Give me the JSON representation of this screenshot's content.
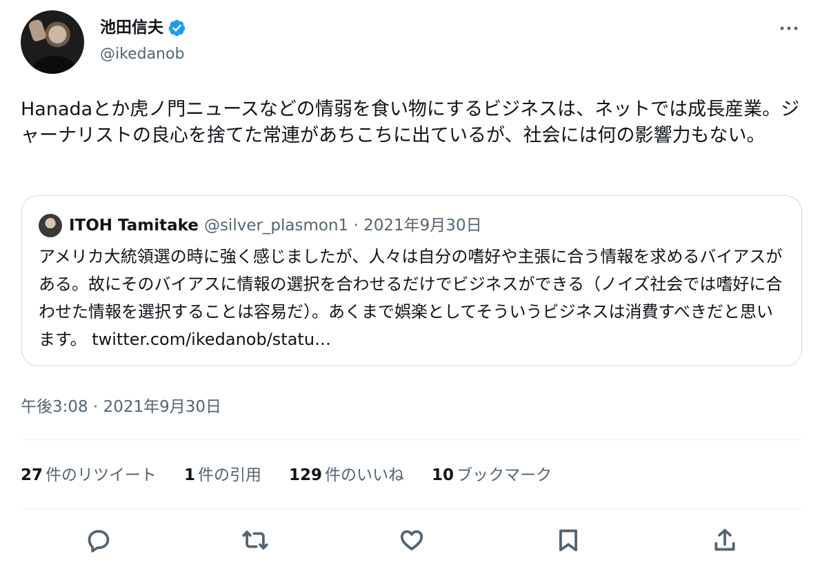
{
  "author": {
    "name": "池田信夫",
    "handle": "@ikedanob"
  },
  "tweet": {
    "text": "Hanadaとか虎ノ門ニュースなどの情弱を食い物にするビジネスは、ネットでは成長産業。ジャーナリストの良心を捨てた常連があちこちに出ているが、社会には何の影響力もない。"
  },
  "quote": {
    "name": "ITOH Tamitake",
    "handle": "@silver_plasmon1",
    "date": "2021年9月30日",
    "text": "アメリカ大統領選の時に強く感じましたが、人々は自分の嗜好や主張に合う情報を求めるバイアスがある。故にそのバイアスに情報の選択を合わせるだけでビジネスができる（ノイズ社会では嗜好に合わせた情報を選択することは容易だ）。あくまで娯楽としてそういうビジネスは消費すべきだと思います。 ",
    "link": "twitter.com/ikedanob/statu…"
  },
  "timestamp": "午後3:08 · 2021年9月30日",
  "stats": {
    "retweets": "27",
    "retweets_label": "件のリツイート",
    "quotes": "1",
    "quotes_label": "件の引用",
    "likes": "129",
    "likes_label": "件のいいね",
    "bookmarks": "10",
    "bookmarks_label": "ブックマーク"
  },
  "icons": {
    "verified": "verified-badge-icon",
    "more": "more-dots-icon",
    "reply": "reply-icon",
    "retweet": "retweet-icon",
    "like": "heart-icon",
    "bookmark": "bookmark-icon",
    "share": "share-icon"
  },
  "colors": {
    "verified": "#1d9bf0",
    "text": "#0f1419",
    "secondary": "#536471",
    "border": "#cfd9de"
  }
}
